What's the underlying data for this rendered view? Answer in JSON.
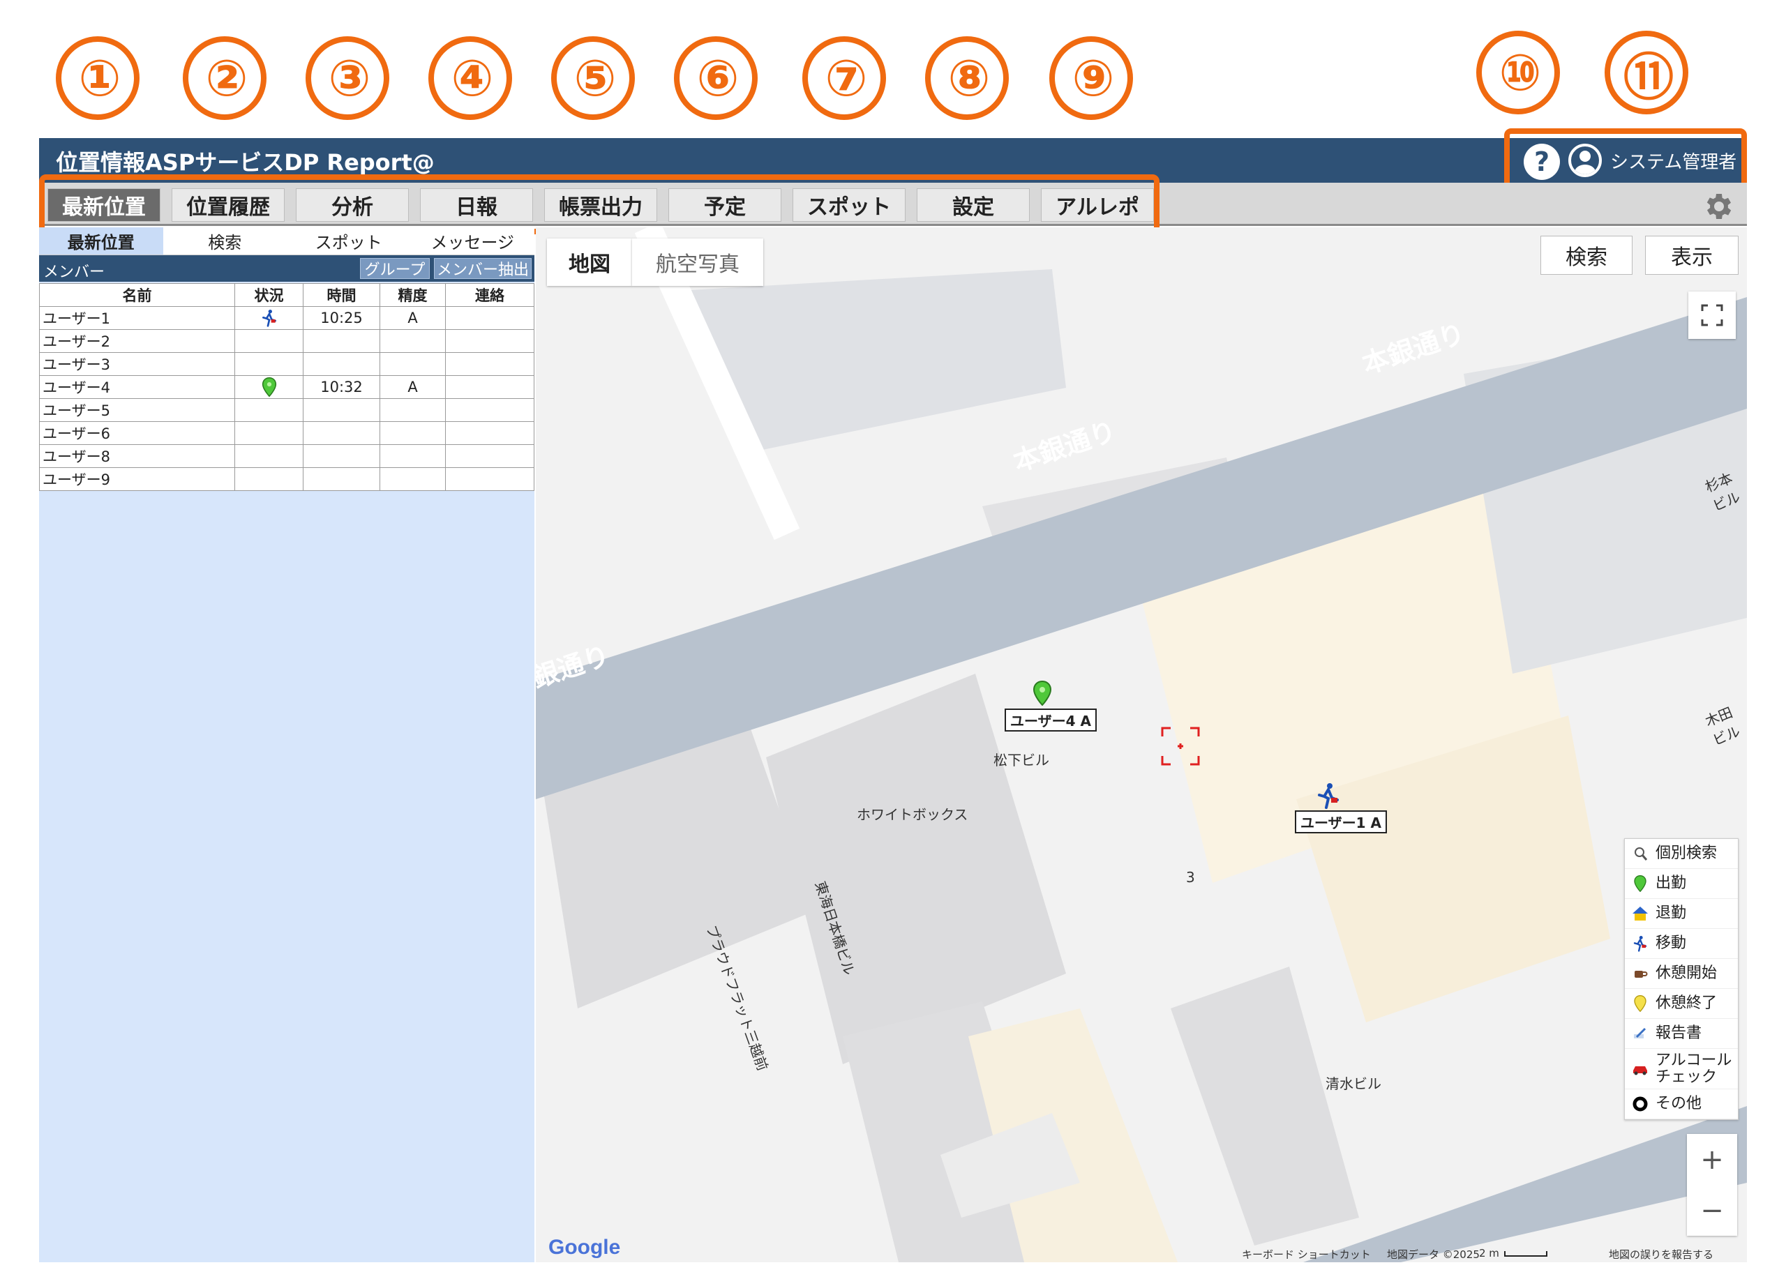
{
  "annotations": [
    "①",
    "②",
    "③",
    "④",
    "⑤",
    "⑥",
    "⑦",
    "⑧",
    "⑨",
    "⑩",
    "⑪"
  ],
  "app": {
    "title": "位置情報ASPサービスDP Report@",
    "user_name": "システム管理者",
    "help_icon": "question-circle-icon",
    "avatar_icon": "user-circle-icon"
  },
  "menu": [
    "最新位置",
    "位置履歴",
    "分析",
    "日報",
    "帳票出力",
    "予定",
    "スポット",
    "設定",
    "アルレポ"
  ],
  "subtabs": [
    "最新位置",
    "検索",
    "スポット",
    "メッセージ"
  ],
  "member_bar": {
    "label": "メンバー",
    "group_button": "グループ",
    "extract_button": "メンバー抽出"
  },
  "table": {
    "headers": [
      "名前",
      "状況",
      "時間",
      "精度",
      "連絡"
    ],
    "rows": [
      {
        "name": "ユーザー1",
        "status": "移動",
        "time": "10:25",
        "accuracy": "A",
        "contact": ""
      },
      {
        "name": "ユーザー2",
        "status": "",
        "time": "",
        "accuracy": "",
        "contact": ""
      },
      {
        "name": "ユーザー3",
        "status": "",
        "time": "",
        "accuracy": "",
        "contact": ""
      },
      {
        "name": "ユーザー4",
        "status": "出勤",
        "time": "10:32",
        "accuracy": "A",
        "contact": ""
      },
      {
        "name": "ユーザー5",
        "status": "",
        "time": "",
        "accuracy": "",
        "contact": ""
      },
      {
        "name": "ユーザー6",
        "status": "",
        "time": "",
        "accuracy": "",
        "contact": ""
      },
      {
        "name": "ユーザー8",
        "status": "",
        "time": "",
        "accuracy": "",
        "contact": ""
      },
      {
        "name": "ユーザー9",
        "status": "",
        "time": "",
        "accuracy": "",
        "contact": ""
      }
    ]
  },
  "map": {
    "tabs": [
      "地図",
      "航空写真"
    ],
    "search_button": "検索",
    "display_button": "表示",
    "street_labels": [
      "本銀通り",
      "本銀通り",
      "銀通り"
    ],
    "place_labels": [
      "松下ビル",
      "ホワイトボックス",
      "東海日本橋ビル",
      "プラウドフラット三越前",
      "清水ビル",
      "杉本ビル",
      "木田ビル"
    ],
    "building_number": "3",
    "markers": [
      {
        "label": "ユーザー4 A",
        "icon": "green-pin-icon"
      },
      {
        "label": "ユーザー1 A",
        "icon": "walker-icon"
      }
    ],
    "legend": [
      {
        "label": "個別検索",
        "icon": "search-person-icon"
      },
      {
        "label": "出勤",
        "icon": "green-pin-icon"
      },
      {
        "label": "退勤",
        "icon": "house-icon"
      },
      {
        "label": "移動",
        "icon": "walker-icon"
      },
      {
        "label": "休憩開始",
        "icon": "coffee-icon"
      },
      {
        "label": "休憩終了",
        "icon": "yellow-pin-icon"
      },
      {
        "label": "報告書",
        "icon": "pencil-icon"
      },
      {
        "label": "アルコールチェック",
        "icon": "car-icon"
      },
      {
        "label": "その他",
        "icon": "black-circle-icon"
      }
    ],
    "zoom_in": "+",
    "zoom_out": "−",
    "google_logo": "Google",
    "footer": {
      "shortcuts": "キーボード ショートカット",
      "data": "地図データ ©2025",
      "scale": "2 m",
      "report": "地図の誤りを報告する"
    }
  },
  "colors": {
    "header": "#2e5176",
    "accent": "#f06a10",
    "panel": "#d7e6fb"
  }
}
